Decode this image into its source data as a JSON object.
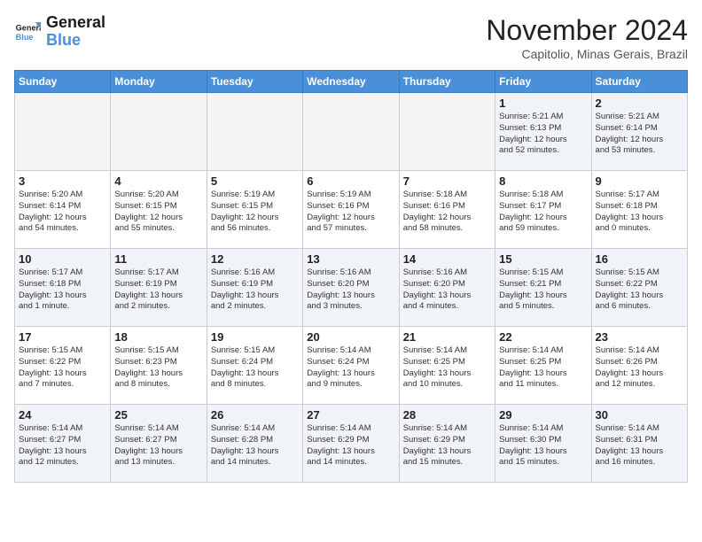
{
  "logo": {
    "line1": "General",
    "line2": "Blue"
  },
  "title": "November 2024",
  "location": "Capitolio, Minas Gerais, Brazil",
  "days_of_week": [
    "Sunday",
    "Monday",
    "Tuesday",
    "Wednesday",
    "Thursday",
    "Friday",
    "Saturday"
  ],
  "weeks": [
    [
      {
        "day": "",
        "info": ""
      },
      {
        "day": "",
        "info": ""
      },
      {
        "day": "",
        "info": ""
      },
      {
        "day": "",
        "info": ""
      },
      {
        "day": "",
        "info": ""
      },
      {
        "day": "1",
        "info": "Sunrise: 5:21 AM\nSunset: 6:13 PM\nDaylight: 12 hours\nand 52 minutes."
      },
      {
        "day": "2",
        "info": "Sunrise: 5:21 AM\nSunset: 6:14 PM\nDaylight: 12 hours\nand 53 minutes."
      }
    ],
    [
      {
        "day": "3",
        "info": "Sunrise: 5:20 AM\nSunset: 6:14 PM\nDaylight: 12 hours\nand 54 minutes."
      },
      {
        "day": "4",
        "info": "Sunrise: 5:20 AM\nSunset: 6:15 PM\nDaylight: 12 hours\nand 55 minutes."
      },
      {
        "day": "5",
        "info": "Sunrise: 5:19 AM\nSunset: 6:15 PM\nDaylight: 12 hours\nand 56 minutes."
      },
      {
        "day": "6",
        "info": "Sunrise: 5:19 AM\nSunset: 6:16 PM\nDaylight: 12 hours\nand 57 minutes."
      },
      {
        "day": "7",
        "info": "Sunrise: 5:18 AM\nSunset: 6:16 PM\nDaylight: 12 hours\nand 58 minutes."
      },
      {
        "day": "8",
        "info": "Sunrise: 5:18 AM\nSunset: 6:17 PM\nDaylight: 12 hours\nand 59 minutes."
      },
      {
        "day": "9",
        "info": "Sunrise: 5:17 AM\nSunset: 6:18 PM\nDaylight: 13 hours\nand 0 minutes."
      }
    ],
    [
      {
        "day": "10",
        "info": "Sunrise: 5:17 AM\nSunset: 6:18 PM\nDaylight: 13 hours\nand 1 minute."
      },
      {
        "day": "11",
        "info": "Sunrise: 5:17 AM\nSunset: 6:19 PM\nDaylight: 13 hours\nand 2 minutes."
      },
      {
        "day": "12",
        "info": "Sunrise: 5:16 AM\nSunset: 6:19 PM\nDaylight: 13 hours\nand 2 minutes."
      },
      {
        "day": "13",
        "info": "Sunrise: 5:16 AM\nSunset: 6:20 PM\nDaylight: 13 hours\nand 3 minutes."
      },
      {
        "day": "14",
        "info": "Sunrise: 5:16 AM\nSunset: 6:20 PM\nDaylight: 13 hours\nand 4 minutes."
      },
      {
        "day": "15",
        "info": "Sunrise: 5:15 AM\nSunset: 6:21 PM\nDaylight: 13 hours\nand 5 minutes."
      },
      {
        "day": "16",
        "info": "Sunrise: 5:15 AM\nSunset: 6:22 PM\nDaylight: 13 hours\nand 6 minutes."
      }
    ],
    [
      {
        "day": "17",
        "info": "Sunrise: 5:15 AM\nSunset: 6:22 PM\nDaylight: 13 hours\nand 7 minutes."
      },
      {
        "day": "18",
        "info": "Sunrise: 5:15 AM\nSunset: 6:23 PM\nDaylight: 13 hours\nand 8 minutes."
      },
      {
        "day": "19",
        "info": "Sunrise: 5:15 AM\nSunset: 6:24 PM\nDaylight: 13 hours\nand 8 minutes."
      },
      {
        "day": "20",
        "info": "Sunrise: 5:14 AM\nSunset: 6:24 PM\nDaylight: 13 hours\nand 9 minutes."
      },
      {
        "day": "21",
        "info": "Sunrise: 5:14 AM\nSunset: 6:25 PM\nDaylight: 13 hours\nand 10 minutes."
      },
      {
        "day": "22",
        "info": "Sunrise: 5:14 AM\nSunset: 6:25 PM\nDaylight: 13 hours\nand 11 minutes."
      },
      {
        "day": "23",
        "info": "Sunrise: 5:14 AM\nSunset: 6:26 PM\nDaylight: 13 hours\nand 12 minutes."
      }
    ],
    [
      {
        "day": "24",
        "info": "Sunrise: 5:14 AM\nSunset: 6:27 PM\nDaylight: 13 hours\nand 12 minutes."
      },
      {
        "day": "25",
        "info": "Sunrise: 5:14 AM\nSunset: 6:27 PM\nDaylight: 13 hours\nand 13 minutes."
      },
      {
        "day": "26",
        "info": "Sunrise: 5:14 AM\nSunset: 6:28 PM\nDaylight: 13 hours\nand 14 minutes."
      },
      {
        "day": "27",
        "info": "Sunrise: 5:14 AM\nSunset: 6:29 PM\nDaylight: 13 hours\nand 14 minutes."
      },
      {
        "day": "28",
        "info": "Sunrise: 5:14 AM\nSunset: 6:29 PM\nDaylight: 13 hours\nand 15 minutes."
      },
      {
        "day": "29",
        "info": "Sunrise: 5:14 AM\nSunset: 6:30 PM\nDaylight: 13 hours\nand 15 minutes."
      },
      {
        "day": "30",
        "info": "Sunrise: 5:14 AM\nSunset: 6:31 PM\nDaylight: 13 hours\nand 16 minutes."
      }
    ]
  ]
}
